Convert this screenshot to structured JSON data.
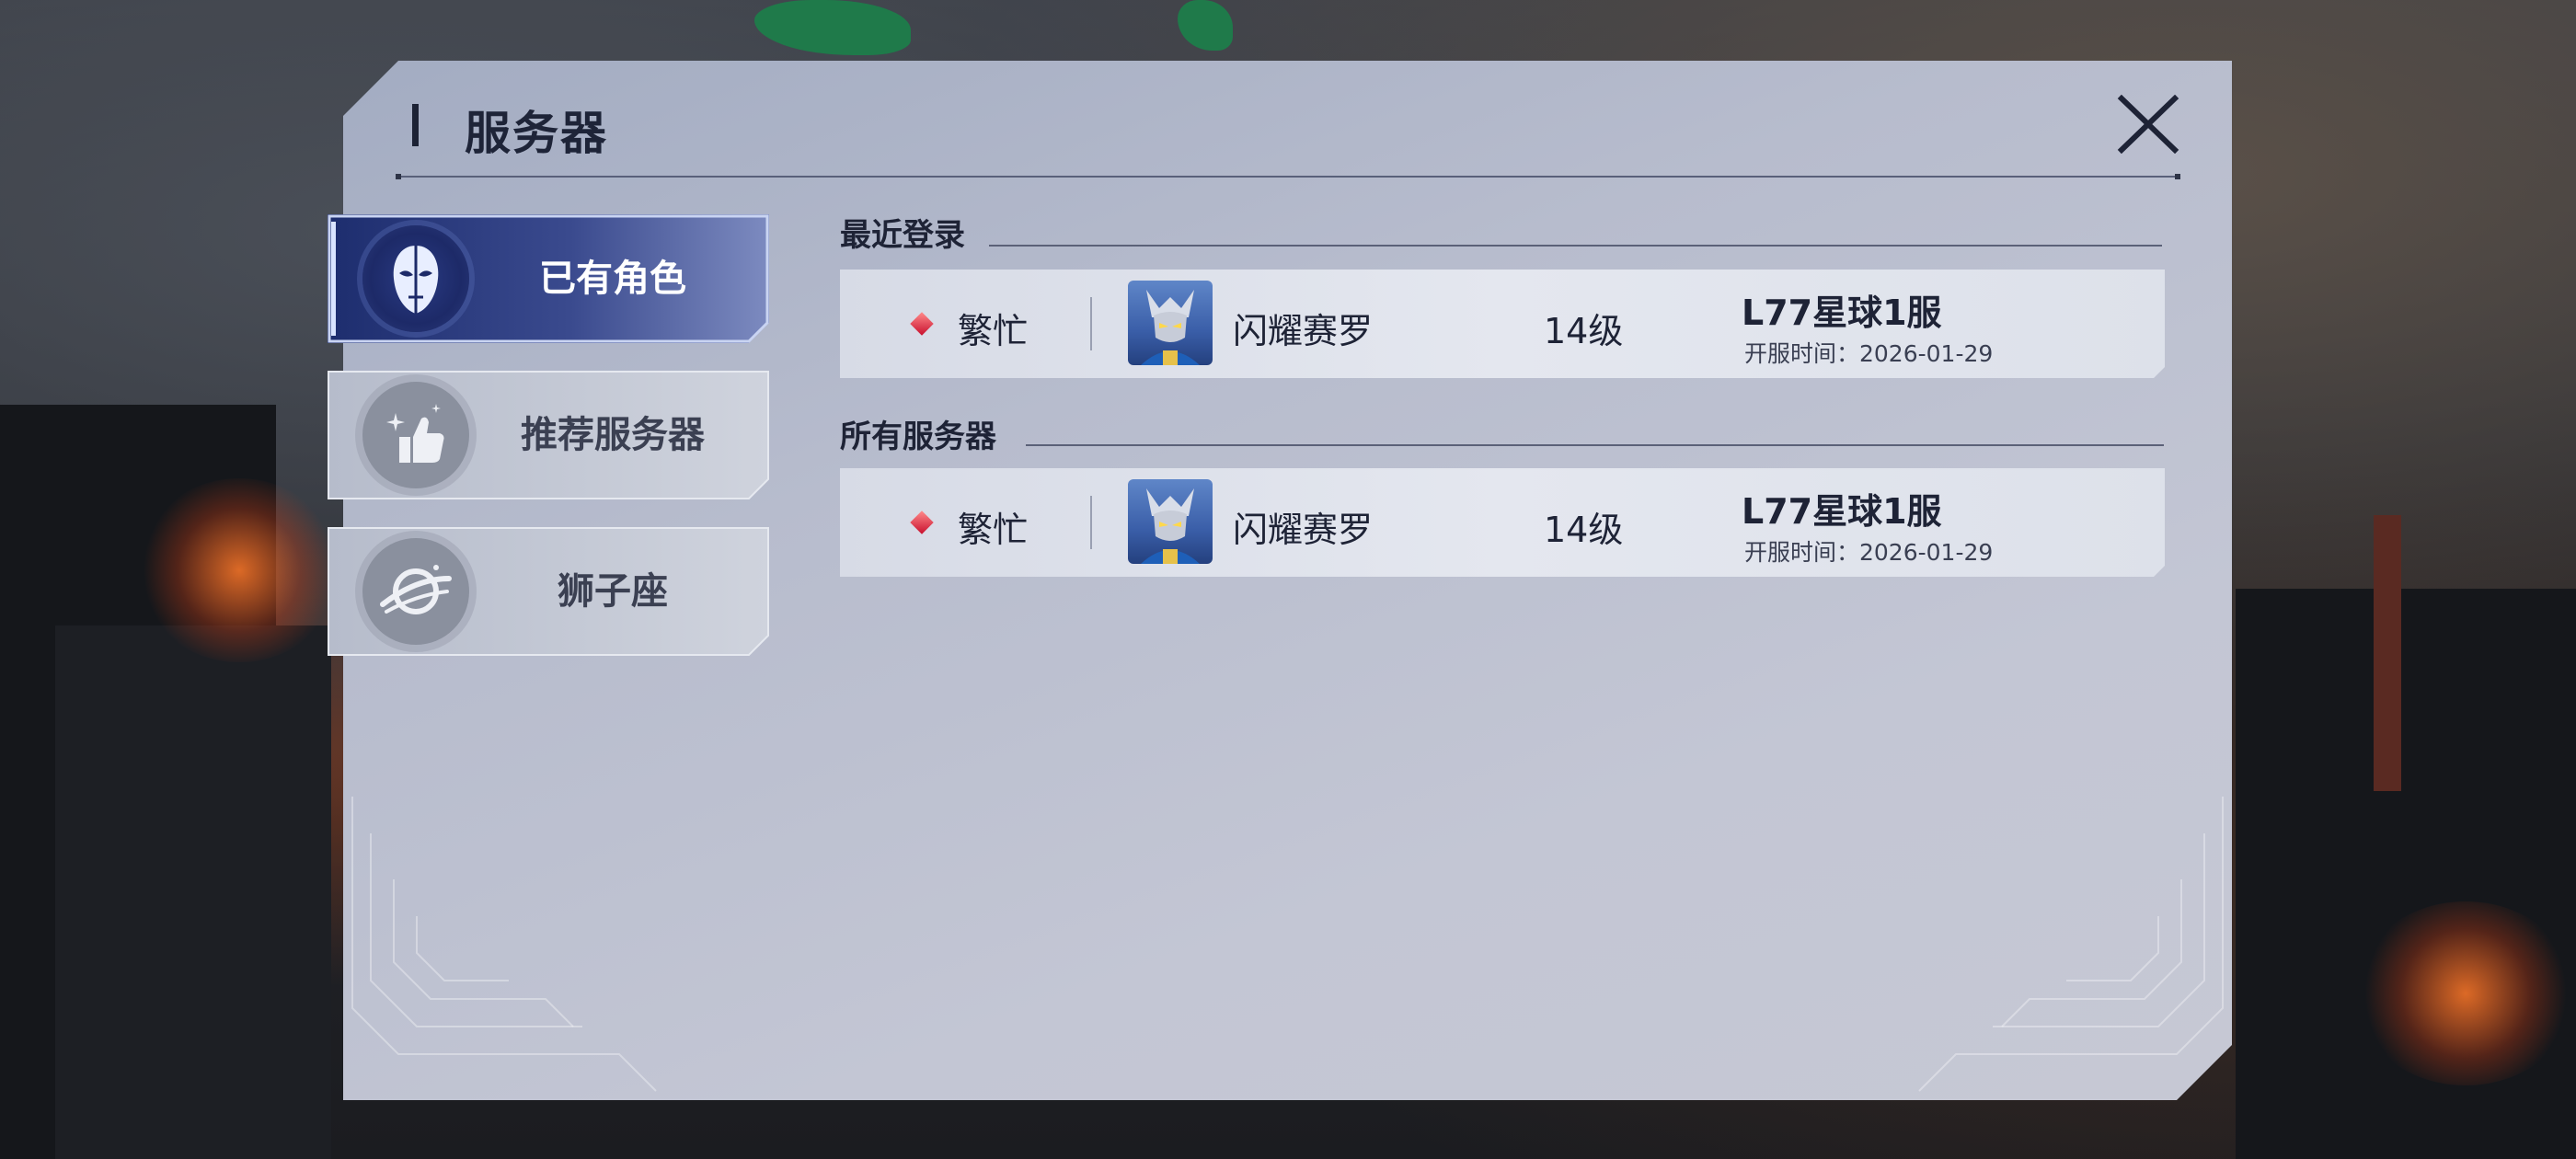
{
  "dialog": {
    "title": "服务器"
  },
  "sidebar": {
    "items": [
      {
        "label": "已有角色",
        "icon": "ultraman-mask-icon",
        "active": true
      },
      {
        "label": "推荐服务器",
        "icon": "thumbs-up-sparkle-icon",
        "active": false
      },
      {
        "label": "狮子座",
        "icon": "planet-icon",
        "active": false
      }
    ]
  },
  "sections": {
    "recent": {
      "title": "最近登录",
      "rows": [
        {
          "status": "繁忙",
          "character": "闪耀赛罗",
          "level": "14级",
          "server": "L77星球1服",
          "open_time": "开服时间：2026-01-29"
        }
      ]
    },
    "all": {
      "title": "所有服务器",
      "rows": [
        {
          "status": "繁忙",
          "character": "闪耀赛罗",
          "level": "14级",
          "server": "L77星球1服",
          "open_time": "开服时间：2026-01-29"
        }
      ]
    }
  },
  "colors": {
    "active_tab": "#1d2d6e",
    "status_busy": "#c8102e",
    "panel": "#b7bccd"
  }
}
